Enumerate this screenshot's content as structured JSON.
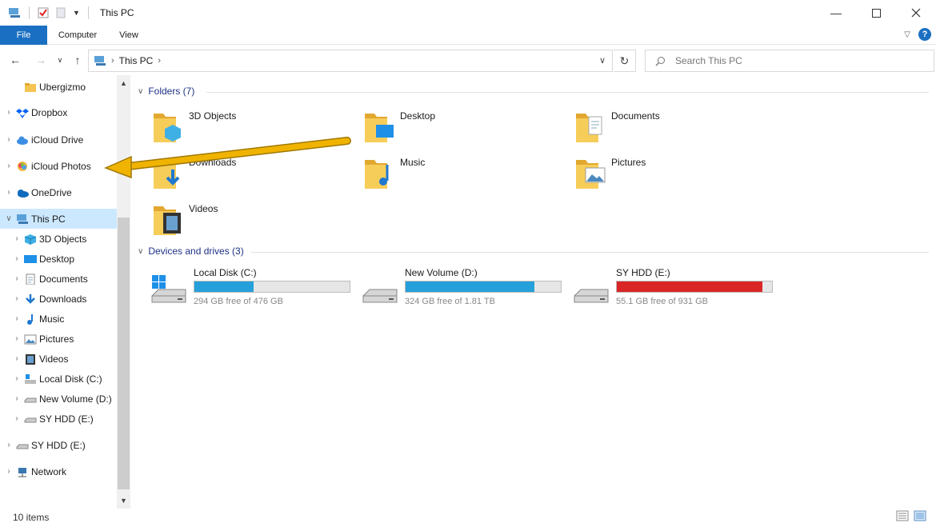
{
  "window": {
    "title": "This PC"
  },
  "ribbon": {
    "tabs": [
      "File",
      "Computer",
      "View"
    ]
  },
  "address": {
    "crumbs": [
      "This PC"
    ],
    "search_placeholder": "Search This PC"
  },
  "nav": {
    "items": [
      {
        "label": "Ubergizmo",
        "indent": 1,
        "icon": "folder-icon"
      },
      {
        "label": "Dropbox",
        "indent": 0,
        "icon": "dropbox-icon"
      },
      {
        "label": "iCloud Drive",
        "indent": 0,
        "icon": "icloud-drive-icon"
      },
      {
        "label": "iCloud Photos",
        "indent": 0,
        "icon": "icloud-photos-icon"
      },
      {
        "label": "OneDrive",
        "indent": 0,
        "icon": "onedrive-icon"
      },
      {
        "label": "This PC",
        "indent": 0,
        "icon": "this-pc-icon",
        "selected": true,
        "expanded": true
      },
      {
        "label": "3D Objects",
        "indent": 1,
        "icon": "3d-objects-icon"
      },
      {
        "label": "Desktop",
        "indent": 1,
        "icon": "desktop-icon"
      },
      {
        "label": "Documents",
        "indent": 1,
        "icon": "documents-icon"
      },
      {
        "label": "Downloads",
        "indent": 1,
        "icon": "downloads-icon"
      },
      {
        "label": "Music",
        "indent": 1,
        "icon": "music-icon"
      },
      {
        "label": "Pictures",
        "indent": 1,
        "icon": "pictures-icon"
      },
      {
        "label": "Videos",
        "indent": 1,
        "icon": "videos-icon"
      },
      {
        "label": "Local Disk (C:)",
        "indent": 1,
        "icon": "local-disk-icon"
      },
      {
        "label": "New Volume (D:)",
        "indent": 1,
        "icon": "drive-icon"
      },
      {
        "label": "SY HDD (E:)",
        "indent": 1,
        "icon": "drive-icon"
      },
      {
        "label": "SY HDD (E:)",
        "indent": 0,
        "icon": "drive-icon"
      },
      {
        "label": "Network",
        "indent": 0,
        "icon": "network-icon"
      }
    ]
  },
  "folders": {
    "heading": "Folders (7)",
    "items": [
      {
        "label": "3D Objects",
        "icon": "3d-objects-folder-icon"
      },
      {
        "label": "Desktop",
        "icon": "desktop-folder-icon"
      },
      {
        "label": "Documents",
        "icon": "documents-folder-icon"
      },
      {
        "label": "Downloads",
        "icon": "downloads-folder-icon"
      },
      {
        "label": "Music",
        "icon": "music-folder-icon"
      },
      {
        "label": "Pictures",
        "icon": "pictures-folder-icon"
      },
      {
        "label": "Videos",
        "icon": "videos-folder-icon"
      }
    ]
  },
  "drives": {
    "heading": "Devices and drives (3)",
    "items": [
      {
        "label": "Local Disk (C:)",
        "free": "294 GB free of 476 GB",
        "used_fraction": 0.38,
        "color": "#26a0da"
      },
      {
        "label": "New Volume (D:)",
        "free": "324 GB free of 1.81 TB",
        "used_fraction": 0.83,
        "color": "#26a0da"
      },
      {
        "label": "SY HDD (E:)",
        "free": "55.1 GB free of 931 GB",
        "used_fraction": 0.94,
        "color": "#da2626"
      }
    ]
  },
  "status": {
    "items": "10 items"
  },
  "colors": {
    "accent": "#1a6fc2",
    "selection": "#cce8ff",
    "annotation_arrow": "#f0b400"
  }
}
